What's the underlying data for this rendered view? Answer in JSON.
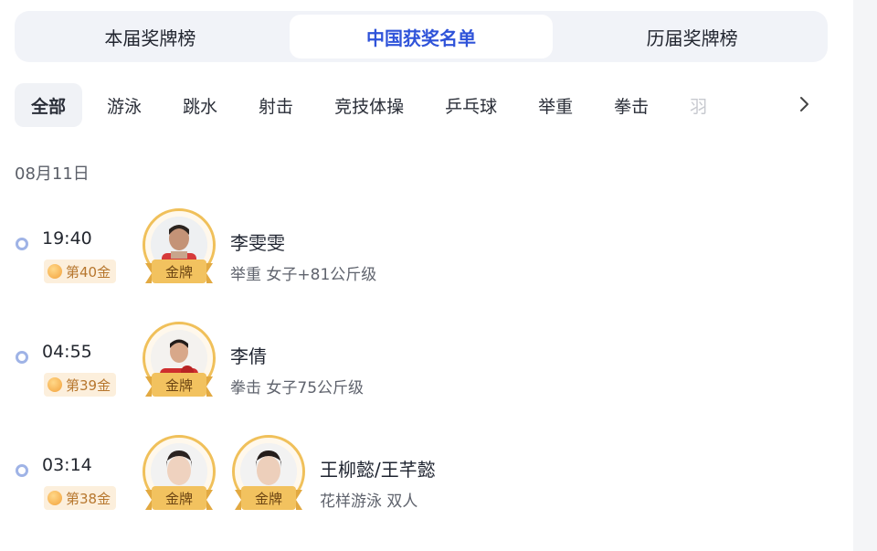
{
  "top_tabs": [
    {
      "label": "本届奖牌榜",
      "active": false
    },
    {
      "label": "中国获奖名单",
      "active": true
    },
    {
      "label": "历届奖牌榜",
      "active": false
    }
  ],
  "sports": [
    "全部",
    "游泳",
    "跳水",
    "射击",
    "竞技体操",
    "乒乓球",
    "举重",
    "拳击",
    "羽"
  ],
  "sports_more_icon": "chevron-right-icon",
  "date": "08月11日",
  "medals": [
    {
      "time": "19:40",
      "rank": "第40金",
      "name": "李雯雯",
      "event": "举重 女子+81公斤级",
      "medal_labels": [
        "金牌"
      ]
    },
    {
      "time": "04:55",
      "rank": "第39金",
      "name": "李倩",
      "event": "拳击 女子75公斤级",
      "medal_labels": [
        "金牌"
      ]
    },
    {
      "time": "03:14",
      "rank": "第38金",
      "name": "王柳懿/王芊懿",
      "event": "花样游泳 双人",
      "medal_labels": [
        "金牌",
        "金牌"
      ]
    }
  ],
  "colors": {
    "accent": "#2f53d9",
    "gold": "#f2c25f",
    "badge_bg": "#fcefdc",
    "badge_text": "#b7772e",
    "timeline_dot": "#9fb3e6"
  }
}
